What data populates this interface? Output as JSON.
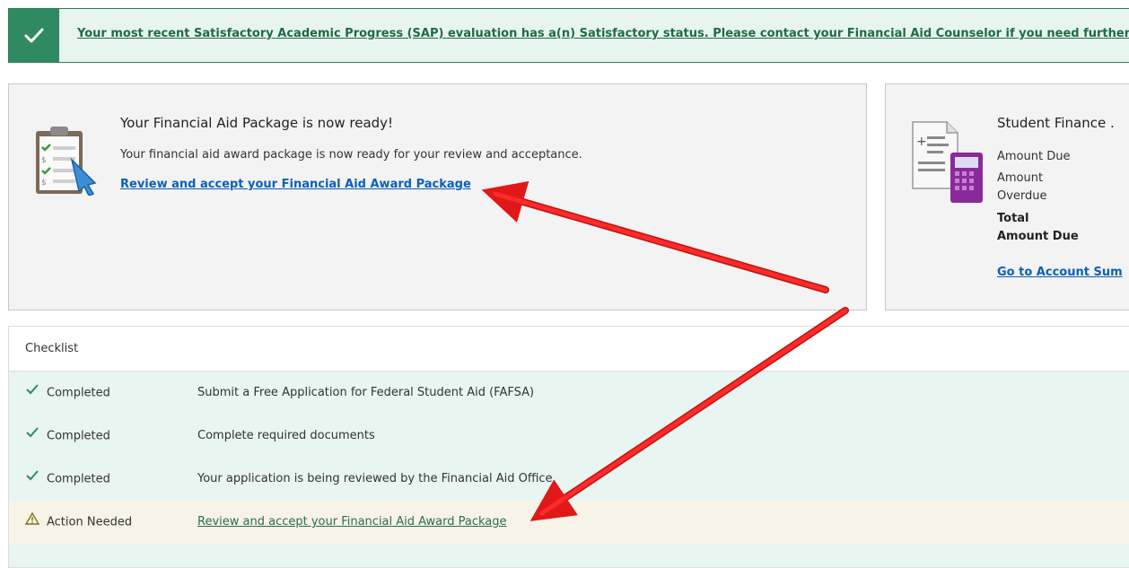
{
  "sap_banner": {
    "message": "Your most recent Satisfactory Academic Progress (SAP) evaluation has a(n) Satisfactory status. Please contact your Financial Aid Counselor if you need further assi"
  },
  "financial_aid_card": {
    "title": "Your Financial Aid Package is now ready!",
    "description": "Your financial aid award package is now ready for your review and acceptance.",
    "link": "Review and accept your Financial Aid Award Package"
  },
  "student_finance_card": {
    "title": "Student Finance .",
    "amount_due": "Amount Due",
    "amount_overdue_line1": "Amount",
    "amount_overdue_line2": "Overdue",
    "total_line1": "Total",
    "total_line2": "Amount Due",
    "link": "Go to Account Sum"
  },
  "checklist": {
    "header": "Checklist",
    "rows": [
      {
        "status": "Completed",
        "description": "Submit a Free Application for Federal Student Aid (FAFSA)"
      },
      {
        "status": "Completed",
        "description": "Complete required documents"
      },
      {
        "status": "Completed",
        "description": "Your application is being reviewed by the Financial Aid Office"
      },
      {
        "status": "Action Needed",
        "description": "Review and accept your Financial Aid Award Package"
      }
    ]
  },
  "colors": {
    "banner_green": "#2f8a61",
    "link_blue": "#0b5fb8",
    "row_completed_bg": "#e9f5f0",
    "row_action_bg": "#f7f3e6",
    "annotation_arrow": "#e01818"
  }
}
